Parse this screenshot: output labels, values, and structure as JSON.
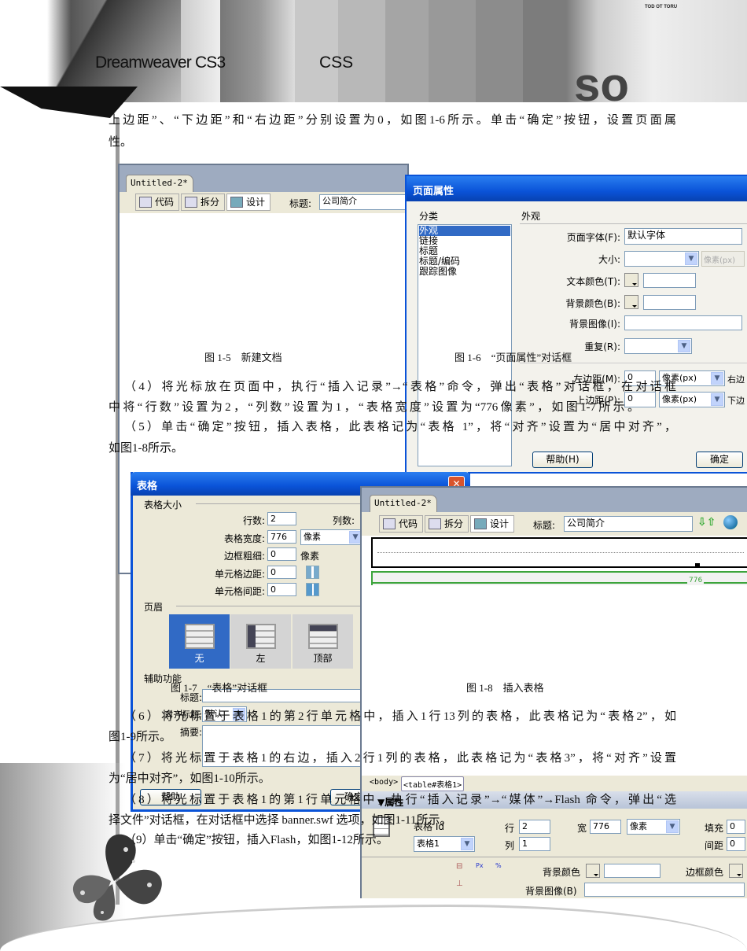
{
  "header": {
    "left_title": "Dreamweaver CS3",
    "right_title": "CSS",
    "banner_small_text": "TOD OT TORU"
  },
  "paragraphs": {
    "p3_line1": "上边距”、“下边距”和“右边距”分别设置为0，如图1-6所示。单击“确定”按钮，设置页面属",
    "p3_line2": "性。",
    "p4_line1": "（4）将光标放在页面中，执行“插入记录”→“表格”命令，弹出“表格”对话框，在对话框",
    "p4_line2": "中将“行数”设置为2，“列数”设置为1，“表格宽度”设置为“776像素”，如图1-7所示。",
    "p5_line1": "（5）单击“确定”按钮，插入表格，此表格记为“表格 1”，将“对齐”设置为“居中对齐”，",
    "p5_line2": "如图1-8所示。",
    "p6_line1": "（6）将光标置于表格1的第2行单元格中，插入1行13列的表格，此表格记为“表格2”，如",
    "p6_line2": "图1-9所示。",
    "p7_line1": "（7）将光标置于表格1的右边，插入2行1列的表格，此表格记为“表格3”，将“对齐”设置",
    "p7_line2": "为“居中对齐”，如图1-10所示。",
    "p8_line1": "（8）将光标置于表格1的第1行单元格中，执行“插入记录”→“媒体”→Flash 命令，弹出“选",
    "p8_line2": "择文件”对话框，在对话框中选择 banner.swf 选项，如图1-11所示。",
    "p9_line1": "（9）单击“确定”按钮，插入Flash，如图1-12所示。"
  },
  "captions": {
    "fig1_5": "图 1-5　新建文档",
    "fig1_6": "图 1-6　“页面属性”对话框",
    "fig1_7": "图 1-7　“表格”对话框",
    "fig1_8": "图 1-8　插入表格"
  },
  "doc_window_1": {
    "tab": "Untitled-2*",
    "code_btn": "代码",
    "split_btn": "拆分",
    "design_btn": "设计",
    "title_label": "标题:",
    "title_value": "公司简介"
  },
  "page_props": {
    "title": "页面属性",
    "category_label": "分类",
    "categories": [
      "外观",
      "链接",
      "标题",
      "标题/编码",
      "跟踪图像"
    ],
    "section": "外观",
    "font_label": "页面字体(F):",
    "font_value": "默认字体",
    "size_label": "大小:",
    "size_unit": "像素(px)",
    "text_color_label": "文本颜色(T):",
    "bg_color_label": "背景颜色(B):",
    "bg_image_label": "背景图像(I):",
    "repeat_label": "重复(R):",
    "left_margin_label": "左边距(M):",
    "left_margin_value": "0",
    "left_unit": "像素(px)",
    "right_margin_label": "右边",
    "top_margin_label": "上边距(P):",
    "top_margin_value": "0",
    "top_unit": "像素(px)",
    "bottom_margin_label": "下边",
    "help_btn": "帮助(H)",
    "ok_btn": "确定"
  },
  "table_dialog": {
    "title": "表格",
    "size_section": "表格大小",
    "rows_label": "行数:",
    "rows_value": "2",
    "cols_label": "列数:",
    "width_label": "表格宽度:",
    "width_value": "776",
    "width_unit": "像素",
    "border_label": "边框粗细:",
    "border_value": "0",
    "border_unit": "像素",
    "padding_label": "单元格边距:",
    "padding_value": "0",
    "spacing_label": "单元格间距:",
    "spacing_value": "0",
    "header_section": "页眉",
    "header_options": [
      "无",
      "左",
      "顶部"
    ],
    "access_section": "辅助功能",
    "caption_label": "标题:",
    "align_caption_label": "对齐标题:",
    "align_caption_value": "默认",
    "summary_label": "摘要:",
    "help_btn": "帮助",
    "ok_btn": "确定"
  },
  "doc_window_2": {
    "tab": "Untitled-2*",
    "code_btn": "代码",
    "split_btn": "拆分",
    "design_btn": "设计",
    "title_label": "标题:",
    "title_value": "公司简介",
    "width_indicator": "776",
    "tag_body": "<body>",
    "tag_table": "<table#表格1>",
    "props_title": "▼属性",
    "table_id_label": "表格 Id",
    "table_id_value": "表格1",
    "row_label": "行",
    "row_value": "2",
    "col_label": "列",
    "col_value": "1",
    "width_label": "宽",
    "width_value": "776",
    "width_unit": "像素",
    "fill_label": "填充",
    "fill_value": "0",
    "spacing_label": "间距",
    "spacing_value": "0",
    "bg_color_label": "背景颜色",
    "border_color_label": "边框颜色",
    "bg_image_label": "背景图像(B)"
  },
  "colors": {
    "xp_blue": "#0a53d8",
    "dialog_bg": "#ece9d8",
    "green_guide": "#3ca43c"
  }
}
